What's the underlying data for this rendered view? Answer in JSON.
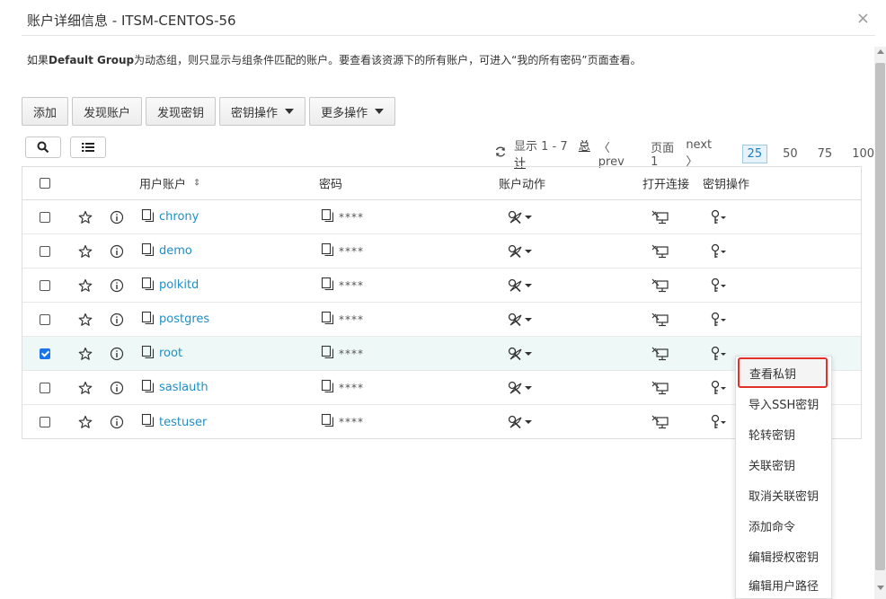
{
  "dialog": {
    "title": "账户详细信息 - ITSM-CENTOS-56",
    "close": "×",
    "notice_prefix": "如果",
    "notice_group": "Default Group",
    "notice_suffix": "为动态组，则只显示与组条件匹配的账户。要查看该资源下的所有账户，可进入“我的所有密码”页面查看。"
  },
  "toolbar": {
    "add": "添加",
    "discover_accounts": "发现账户",
    "discover_keys": "发现密钥",
    "key_ops": "密钥操作",
    "more_ops": "更多操作"
  },
  "icons": {
    "search": "search-icon",
    "list": "list-icon",
    "refresh": "refresh-icon",
    "star": "star-icon",
    "info": "info-icon",
    "copy": "copy-icon",
    "account_action": "account-action-icon",
    "connect": "connect-icon",
    "key": "key-icon"
  },
  "pager": {
    "showing": "显示 1 - 7",
    "total": "总计",
    "prev": "prev",
    "page": "页面 1",
    "next": "next",
    "sizes": [
      "25",
      "50",
      "75",
      "100"
    ],
    "active_size": "25"
  },
  "table": {
    "columns": {
      "account": "用户账户",
      "password": "密码",
      "account_action": "账户动作",
      "open_connection": "打开连接",
      "key_ops": "密钥操作"
    },
    "rows": [
      {
        "name": "chrony",
        "password": "****",
        "checked": false
      },
      {
        "name": "demo",
        "password": "****",
        "checked": false
      },
      {
        "name": "polkitd",
        "password": "****",
        "checked": false
      },
      {
        "name": "postgres",
        "password": "****",
        "checked": false
      },
      {
        "name": "root",
        "password": "****",
        "checked": true
      },
      {
        "name": "saslauth",
        "password": "****",
        "checked": false
      },
      {
        "name": "testuser",
        "password": "****",
        "checked": false
      }
    ]
  },
  "menu": {
    "items": [
      "查看私钥",
      "导入SSH密钥",
      "轮转密钥",
      "关联密钥",
      "取消关联密钥",
      "添加命令",
      "编辑授权密钥",
      "编辑用户路径"
    ],
    "highlight": "查看私钥",
    "highlight_color": "#e0322b"
  },
  "colors": {
    "link": "#1e8fc6",
    "selected_row": "#eef8f6",
    "checkbox_checked": "#1a73e8"
  }
}
